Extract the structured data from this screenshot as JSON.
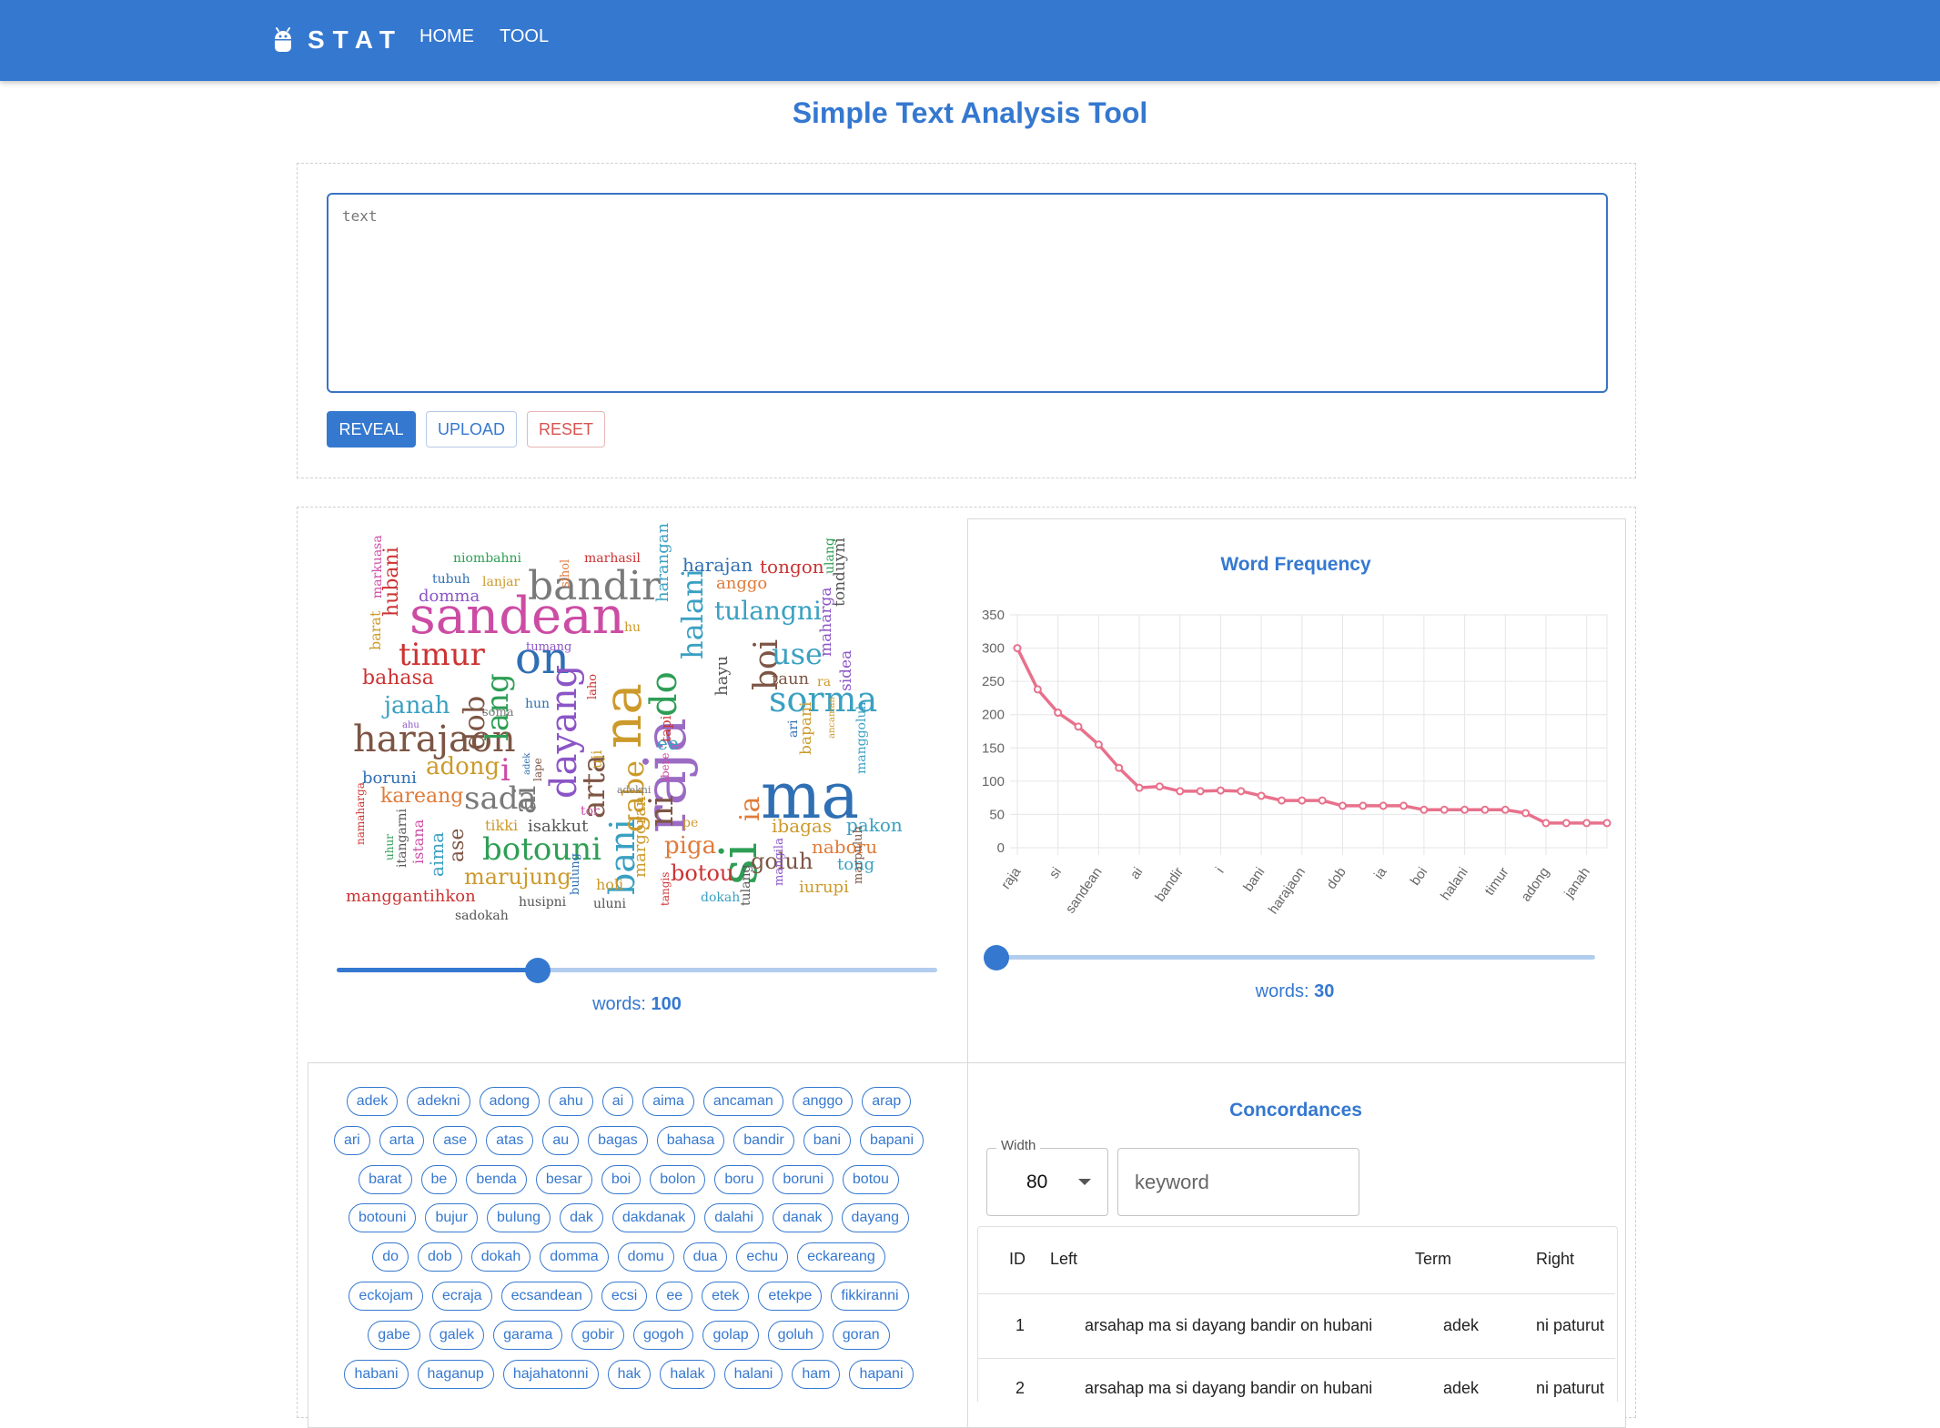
{
  "header": {
    "brand": "STAT",
    "nav": [
      "HOME",
      "TOOL"
    ]
  },
  "page_title": "Simple Text Analysis Tool",
  "input": {
    "placeholder": "text",
    "buttons": {
      "reveal": "REVEAL",
      "upload": "UPLOAD",
      "reset": "RESET"
    }
  },
  "wordcloud": {
    "words": [
      "ma",
      "raja",
      "si",
      "sandean",
      "na",
      "on",
      "bandir",
      "harajaon",
      "dayang",
      "botouni",
      "sada",
      "bani",
      "do",
      "timur",
      "sorma",
      "ai",
      "gabe",
      "boi",
      "dob",
      "arta",
      "i",
      "halani",
      "ni",
      "lang",
      "adong",
      "tulangni",
      "use",
      "janah",
      "piga",
      "ia",
      "botou",
      "kareang",
      "marujung",
      "bahasa",
      "ase",
      "naboru",
      "goluh",
      "ibagas",
      "pakon",
      "hubani",
      "tongon",
      "harajan",
      "harangan",
      "boruni",
      "isakkut",
      "margoran",
      "domma",
      "iurupi",
      "manggantihkon",
      "hayu",
      "anggo",
      "marhasil",
      "niombahni",
      "tubuh",
      "lanjar",
      "sihol",
      "tumang",
      "uji",
      "hu",
      "laho",
      "tapi",
      "hun",
      "soma",
      "ee",
      "taun",
      "tonduyni",
      "maharga",
      "sidea",
      "bapani",
      "ari",
      "ra",
      "ulang",
      "tong",
      "manggoluh",
      "pe",
      "tor",
      "tikki",
      "adek",
      "lape",
      "adekni",
      "ibere",
      "ahu",
      "barat",
      "markuasa",
      "aima",
      "istana",
      "itangarni",
      "uhur",
      "namaharga",
      "holi",
      "bulung",
      "husipni",
      "uluni",
      "tangis",
      "dokah",
      "tulang",
      "mangila",
      "marpuluh",
      "sadokah",
      "ancaman"
    ],
    "slider_label": "words:",
    "slider_value": 100,
    "slider_fraction": 0.335
  },
  "frequency": {
    "title": "Word Frequency",
    "slider_label": "words:",
    "slider_value": 30,
    "slider_fraction": 0.0
  },
  "chart_data": {
    "type": "line",
    "title": "Word Frequency",
    "xlabel": "",
    "ylabel": "",
    "ylim": [
      0,
      350
    ],
    "yticks": [
      0,
      50,
      100,
      150,
      200,
      250,
      300,
      350
    ],
    "x_tick_labels": [
      "raja",
      "si",
      "sandean",
      "ai",
      "bandir",
      "i",
      "bani",
      "harajaon",
      "dob",
      "ia",
      "boi",
      "halani",
      "timur",
      "adong",
      "janah"
    ],
    "series": [
      {
        "values": [
          300,
          238,
          203,
          182,
          155,
          120,
          90,
          92,
          85,
          85,
          86,
          85,
          78,
          71,
          71,
          71,
          63,
          63,
          63,
          63,
          57,
          57,
          57,
          57,
          57,
          52,
          37,
          37,
          37,
          37
        ]
      }
    ],
    "grid": true,
    "line_color": "#e8718c"
  },
  "tags": {
    "rows": [
      [
        "adek",
        "adekni",
        "adong",
        "ahu",
        "ai",
        "aima",
        "ancaman",
        "anggo",
        "arap"
      ],
      [
        "ari",
        "arta",
        "ase",
        "atas",
        "au",
        "bagas",
        "bahasa",
        "bandir",
        "bani",
        "bapani"
      ],
      [
        "barat",
        "be",
        "benda",
        "besar",
        "boi",
        "bolon",
        "boru",
        "boruni",
        "botou"
      ],
      [
        "botouni",
        "bujur",
        "bulung",
        "dak",
        "dakdanak",
        "dalahi",
        "danak",
        "dayang"
      ],
      [
        "do",
        "dob",
        "dokah",
        "domma",
        "domu",
        "dua",
        "echu",
        "eckareang"
      ],
      [
        "eckojam",
        "ecraja",
        "ecsandean",
        "ecsi",
        "ee",
        "etek",
        "etekpe",
        "fikkiranni"
      ],
      [
        "gabe",
        "galek",
        "garama",
        "gobir",
        "gogoh",
        "golap",
        "goluh",
        "goran"
      ],
      [
        "habani",
        "haganup",
        "hajahatonni",
        "hak",
        "halak",
        "halani",
        "ham",
        "hapani"
      ]
    ]
  },
  "concordances": {
    "title": "Concordances",
    "width_label": "Width",
    "width_value": "80",
    "keyword_placeholder": "keyword",
    "columns": [
      "ID",
      "Left",
      "Term",
      "Right"
    ],
    "rows": [
      {
        "id": "1",
        "left": "arsahap ma si dayang bandir on hubani",
        "term": "adek",
        "right": "ni paturut"
      },
      {
        "id": "2",
        "left": "arsahap ma si dayang bandir on hubani",
        "term": "adek",
        "right": "ni paturut"
      }
    ]
  },
  "colors": {
    "primary": "#3578d0",
    "danger": "#d9534f",
    "line": "#e8718c"
  }
}
